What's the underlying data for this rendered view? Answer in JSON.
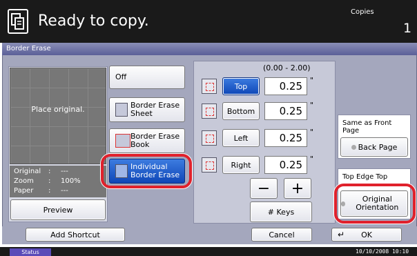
{
  "header": {
    "title": "Ready to copy.",
    "copies_label": "Copies",
    "copies_value": "1",
    "icon": "copy-document-icon"
  },
  "panel": {
    "title": "Border Erase"
  },
  "preview": {
    "placeholder": "Place original.",
    "info": [
      {
        "key": "Original",
        "value": "---"
      },
      {
        "key": "Zoom",
        "value": "100%"
      },
      {
        "key": "Paper",
        "value": "---"
      }
    ],
    "button": "Preview"
  },
  "modes": {
    "off": "Off",
    "sheet": "Border Erase Sheet",
    "book": "Border Erase Book",
    "individual": "Individual Border Erase",
    "selected": "individual"
  },
  "edges": {
    "range": "(0.00 - 2.00)",
    "unit_mark": "\"",
    "top": {
      "label": "Top",
      "value": "0.25"
    },
    "bottom": {
      "label": "Bottom",
      "value": "0.25"
    },
    "left": {
      "label": "Left",
      "value": "0.25"
    },
    "right": {
      "label": "Right",
      "value": "0.25"
    },
    "selected": "top",
    "minus": "−",
    "plus": "+",
    "keys": "# Keys"
  },
  "back_page": {
    "label": "Same as Front Page",
    "button": "Back Page"
  },
  "orientation": {
    "label": "Top Edge Top",
    "button": "Original Orientation"
  },
  "bottom": {
    "shortcut": "Add Shortcut",
    "cancel": "Cancel",
    "ok": "OK"
  },
  "status": {
    "tab": "Status",
    "datetime": "10/10/2008  10:10"
  },
  "colors": {
    "selected": "#0e46b7",
    "highlight": "#e0212c",
    "panel": "#a4a7bd"
  }
}
